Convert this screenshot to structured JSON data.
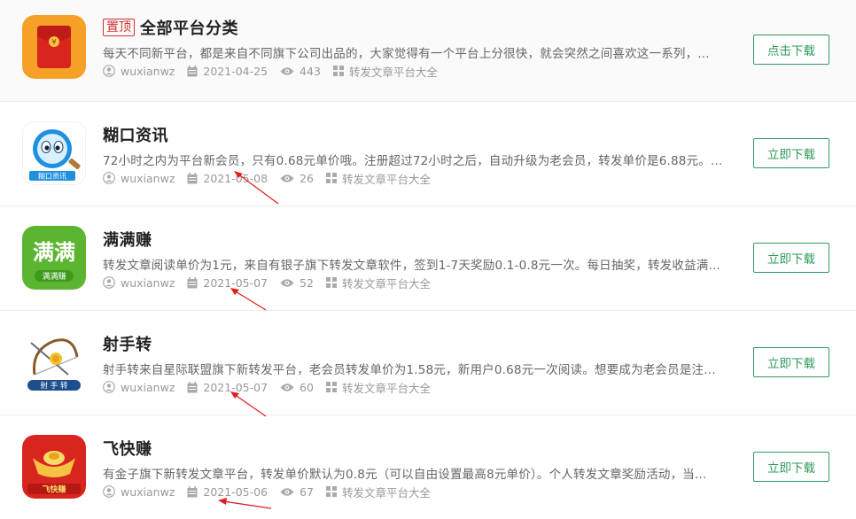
{
  "colors": {
    "accent_green": "#2e9a5a",
    "pin_red": "#d0322e",
    "annotation_arrow": "#e02020"
  },
  "icons": {
    "author": "user-circle-icon",
    "date": "calendar-icon",
    "views": "eye-icon",
    "category": "grid-icon"
  },
  "items": [
    {
      "pin": "置顶",
      "title": "全部平台分类",
      "desc": "每天不同新平台，都是来自不同旗下公司出品的，大家觉得有一个平台上分很快，就会突然之间喜欢这一系列，...",
      "author": "wuxianwz",
      "date": "2021-04-25",
      "views": "443",
      "category": "转发文章平台大全",
      "button": "点击下载",
      "logo_icon": "red-envelope-icon"
    },
    {
      "title": "糊口资讯",
      "desc": "72小时之内为平台新会员，只有0.68元单价哦。注册超过72小时之后，自动升级为老会员，转发单价是6.88元。...",
      "author": "wuxianwz",
      "date": "2021-05-08",
      "views": "26",
      "category": "转发文章平台大全",
      "button": "立即下载",
      "logo_icon": "magnifier-mascot-icon",
      "logo_text": "糊口资讯"
    },
    {
      "title": "满满赚",
      "desc": "转发文章阅读单价为1元，来自有银子旗下转发文章软件，签到1-7天奖励0.1-0.8元一次。每日抽奖，转发收益满...",
      "author": "wuxianwz",
      "date": "2021-05-07",
      "views": "52",
      "category": "转发文章平台大全",
      "button": "立即下载",
      "logo_icon": "manmanzhuan-logo-icon",
      "logo_text": "满满",
      "logo_subtext": "满满赚"
    },
    {
      "title": "射手转",
      "desc": "射手转来自星际联盟旗下新转发平台，老会员转发单价为1.58元，新用户0.68元一次阅读。想要成为老会员是注...",
      "author": "wuxianwz",
      "date": "2021-05-07",
      "views": "60",
      "category": "转发文章平台大全",
      "button": "立即下载",
      "logo_icon": "bow-arrow-icon",
      "logo_text": "射 手 转"
    },
    {
      "title": "飞快赚",
      "desc": "有金子旗下新转发文章平台，转发单价默认为0.8元（可以自由设置最高8元单价）。个人转发文章奖励活动，当...",
      "author": "wuxianwz",
      "date": "2021-05-06",
      "views": "67",
      "category": "转发文章平台大全",
      "button": "立即下载",
      "logo_icon": "gold-ingot-icon",
      "logo_text": "飞快赚"
    }
  ]
}
